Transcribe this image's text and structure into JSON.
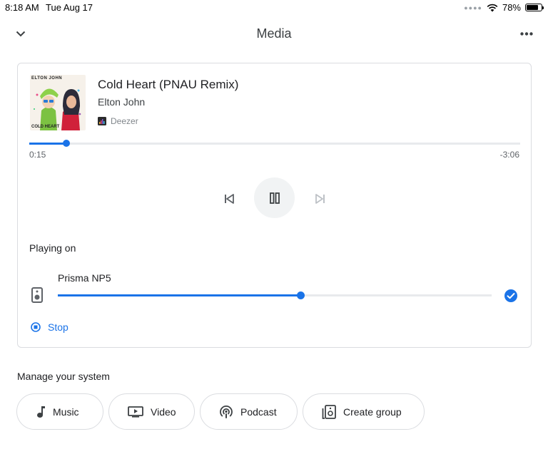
{
  "status_bar": {
    "time": "8:18 AM",
    "date": "Tue Aug 17",
    "battery": "78%",
    "battery_level": 0.78
  },
  "header": {
    "title": "Media"
  },
  "now_playing": {
    "album_art_text": "ELTON JOHN",
    "album_art_caption": "COLD HEART",
    "title": "Cold Heart (PNAU Remix)",
    "artist": "Elton John",
    "source": "Deezer",
    "elapsed": "0:15",
    "remaining": "-3:06",
    "progress": 0.075
  },
  "playing_on": {
    "label": "Playing on",
    "device_name": "Prisma NP5",
    "volume": 0.56,
    "stop_label": "Stop"
  },
  "manage": {
    "label": "Manage your system",
    "chips": [
      {
        "label": "Music",
        "icon": "music-note-icon"
      },
      {
        "label": "Video",
        "icon": "video-icon"
      },
      {
        "label": "Podcast",
        "icon": "podcast-icon"
      },
      {
        "label": "Create group",
        "icon": "speaker-group-icon"
      }
    ]
  },
  "colors": {
    "accent": "#1a73e8",
    "track": "#e8eaed",
    "border": "#dadce0"
  }
}
